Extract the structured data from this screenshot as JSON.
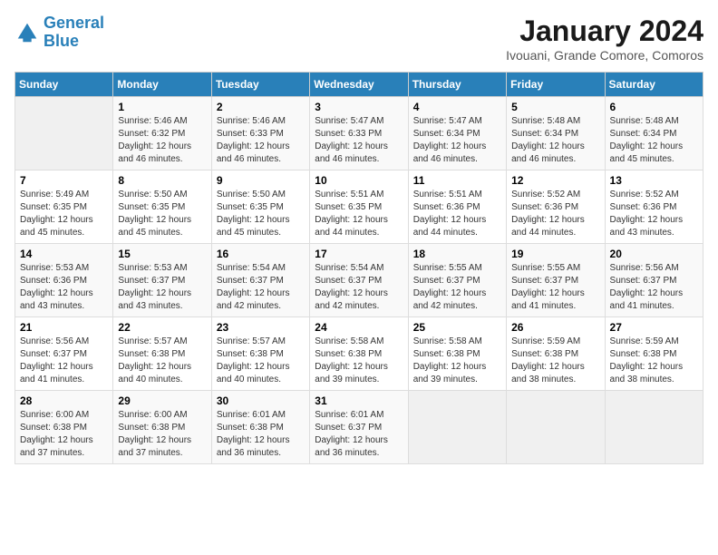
{
  "logo": {
    "text_general": "General",
    "text_blue": "Blue"
  },
  "title": "January 2024",
  "subtitle": "Ivouani, Grande Comore, Comoros",
  "days_of_week": [
    "Sunday",
    "Monday",
    "Tuesday",
    "Wednesday",
    "Thursday",
    "Friday",
    "Saturday"
  ],
  "weeks": [
    [
      {
        "day": "",
        "sunrise": "",
        "sunset": "",
        "daylight": ""
      },
      {
        "day": "1",
        "sunrise": "Sunrise: 5:46 AM",
        "sunset": "Sunset: 6:32 PM",
        "daylight": "Daylight: 12 hours and 46 minutes."
      },
      {
        "day": "2",
        "sunrise": "Sunrise: 5:46 AM",
        "sunset": "Sunset: 6:33 PM",
        "daylight": "Daylight: 12 hours and 46 minutes."
      },
      {
        "day": "3",
        "sunrise": "Sunrise: 5:47 AM",
        "sunset": "Sunset: 6:33 PM",
        "daylight": "Daylight: 12 hours and 46 minutes."
      },
      {
        "day": "4",
        "sunrise": "Sunrise: 5:47 AM",
        "sunset": "Sunset: 6:34 PM",
        "daylight": "Daylight: 12 hours and 46 minutes."
      },
      {
        "day": "5",
        "sunrise": "Sunrise: 5:48 AM",
        "sunset": "Sunset: 6:34 PM",
        "daylight": "Daylight: 12 hours and 46 minutes."
      },
      {
        "day": "6",
        "sunrise": "Sunrise: 5:48 AM",
        "sunset": "Sunset: 6:34 PM",
        "daylight": "Daylight: 12 hours and 45 minutes."
      }
    ],
    [
      {
        "day": "7",
        "sunrise": "Sunrise: 5:49 AM",
        "sunset": "Sunset: 6:35 PM",
        "daylight": "Daylight: 12 hours and 45 minutes."
      },
      {
        "day": "8",
        "sunrise": "Sunrise: 5:50 AM",
        "sunset": "Sunset: 6:35 PM",
        "daylight": "Daylight: 12 hours and 45 minutes."
      },
      {
        "day": "9",
        "sunrise": "Sunrise: 5:50 AM",
        "sunset": "Sunset: 6:35 PM",
        "daylight": "Daylight: 12 hours and 45 minutes."
      },
      {
        "day": "10",
        "sunrise": "Sunrise: 5:51 AM",
        "sunset": "Sunset: 6:35 PM",
        "daylight": "Daylight: 12 hours and 44 minutes."
      },
      {
        "day": "11",
        "sunrise": "Sunrise: 5:51 AM",
        "sunset": "Sunset: 6:36 PM",
        "daylight": "Daylight: 12 hours and 44 minutes."
      },
      {
        "day": "12",
        "sunrise": "Sunrise: 5:52 AM",
        "sunset": "Sunset: 6:36 PM",
        "daylight": "Daylight: 12 hours and 44 minutes."
      },
      {
        "day": "13",
        "sunrise": "Sunrise: 5:52 AM",
        "sunset": "Sunset: 6:36 PM",
        "daylight": "Daylight: 12 hours and 43 minutes."
      }
    ],
    [
      {
        "day": "14",
        "sunrise": "Sunrise: 5:53 AM",
        "sunset": "Sunset: 6:36 PM",
        "daylight": "Daylight: 12 hours and 43 minutes."
      },
      {
        "day": "15",
        "sunrise": "Sunrise: 5:53 AM",
        "sunset": "Sunset: 6:37 PM",
        "daylight": "Daylight: 12 hours and 43 minutes."
      },
      {
        "day": "16",
        "sunrise": "Sunrise: 5:54 AM",
        "sunset": "Sunset: 6:37 PM",
        "daylight": "Daylight: 12 hours and 42 minutes."
      },
      {
        "day": "17",
        "sunrise": "Sunrise: 5:54 AM",
        "sunset": "Sunset: 6:37 PM",
        "daylight": "Daylight: 12 hours and 42 minutes."
      },
      {
        "day": "18",
        "sunrise": "Sunrise: 5:55 AM",
        "sunset": "Sunset: 6:37 PM",
        "daylight": "Daylight: 12 hours and 42 minutes."
      },
      {
        "day": "19",
        "sunrise": "Sunrise: 5:55 AM",
        "sunset": "Sunset: 6:37 PM",
        "daylight": "Daylight: 12 hours and 41 minutes."
      },
      {
        "day": "20",
        "sunrise": "Sunrise: 5:56 AM",
        "sunset": "Sunset: 6:37 PM",
        "daylight": "Daylight: 12 hours and 41 minutes."
      }
    ],
    [
      {
        "day": "21",
        "sunrise": "Sunrise: 5:56 AM",
        "sunset": "Sunset: 6:37 PM",
        "daylight": "Daylight: 12 hours and 41 minutes."
      },
      {
        "day": "22",
        "sunrise": "Sunrise: 5:57 AM",
        "sunset": "Sunset: 6:38 PM",
        "daylight": "Daylight: 12 hours and 40 minutes."
      },
      {
        "day": "23",
        "sunrise": "Sunrise: 5:57 AM",
        "sunset": "Sunset: 6:38 PM",
        "daylight": "Daylight: 12 hours and 40 minutes."
      },
      {
        "day": "24",
        "sunrise": "Sunrise: 5:58 AM",
        "sunset": "Sunset: 6:38 PM",
        "daylight": "Daylight: 12 hours and 39 minutes."
      },
      {
        "day": "25",
        "sunrise": "Sunrise: 5:58 AM",
        "sunset": "Sunset: 6:38 PM",
        "daylight": "Daylight: 12 hours and 39 minutes."
      },
      {
        "day": "26",
        "sunrise": "Sunrise: 5:59 AM",
        "sunset": "Sunset: 6:38 PM",
        "daylight": "Daylight: 12 hours and 38 minutes."
      },
      {
        "day": "27",
        "sunrise": "Sunrise: 5:59 AM",
        "sunset": "Sunset: 6:38 PM",
        "daylight": "Daylight: 12 hours and 38 minutes."
      }
    ],
    [
      {
        "day": "28",
        "sunrise": "Sunrise: 6:00 AM",
        "sunset": "Sunset: 6:38 PM",
        "daylight": "Daylight: 12 hours and 37 minutes."
      },
      {
        "day": "29",
        "sunrise": "Sunrise: 6:00 AM",
        "sunset": "Sunset: 6:38 PM",
        "daylight": "Daylight: 12 hours and 37 minutes."
      },
      {
        "day": "30",
        "sunrise": "Sunrise: 6:01 AM",
        "sunset": "Sunset: 6:38 PM",
        "daylight": "Daylight: 12 hours and 36 minutes."
      },
      {
        "day": "31",
        "sunrise": "Sunrise: 6:01 AM",
        "sunset": "Sunset: 6:37 PM",
        "daylight": "Daylight: 12 hours and 36 minutes."
      },
      {
        "day": "",
        "sunrise": "",
        "sunset": "",
        "daylight": ""
      },
      {
        "day": "",
        "sunrise": "",
        "sunset": "",
        "daylight": ""
      },
      {
        "day": "",
        "sunrise": "",
        "sunset": "",
        "daylight": ""
      }
    ]
  ]
}
